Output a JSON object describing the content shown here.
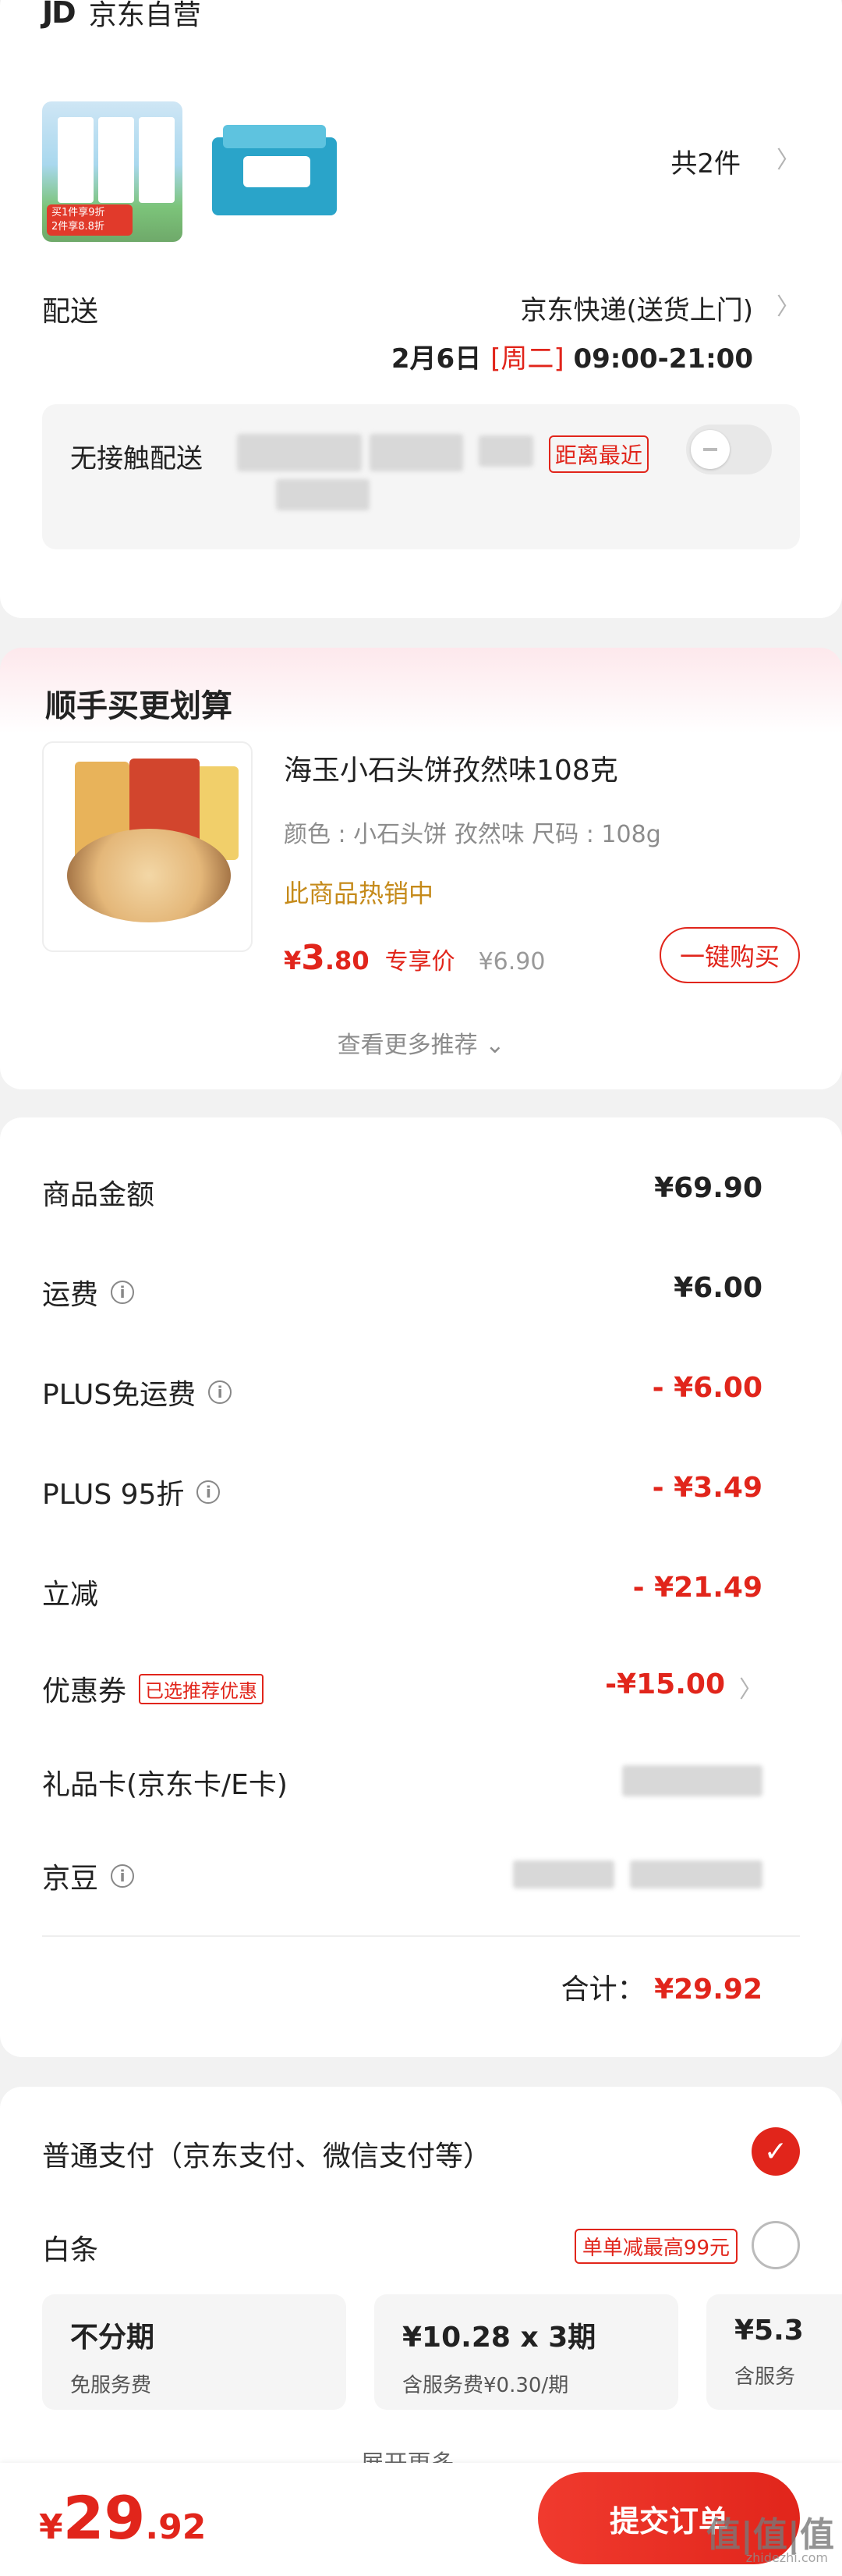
{
  "store": {
    "logo": "JD",
    "name": "京东自营"
  },
  "items": {
    "count_label": "共2件"
  },
  "thumb1": {
    "tag_line1": "买1件享9折",
    "tag_line2": "2件享8.8折"
  },
  "shipping": {
    "label": "配送",
    "type": "京东快递(送货上门)",
    "date": "2月6日",
    "weekday": "[周二]",
    "time": "09:00-21:00",
    "contactless_label": "无接触配送",
    "nearest_tag": "距离最近"
  },
  "addon": {
    "title": "顺手买更划算",
    "product_name": "海玉小石头饼孜然味108克",
    "spec": "颜色 : 小石头饼 孜然味   尺码 : 108g",
    "hot": "此商品热销中",
    "price_symbol": "¥",
    "price_int": "3",
    "price_dec": ".80",
    "exclusive": "专享价",
    "original_price": "¥6.90",
    "buy_label": "一键购买",
    "more_label": "查看更多推荐 ⌄"
  },
  "summary": {
    "goods_label": "商品金额",
    "goods_value": "¥69.90",
    "freight_label": "运费",
    "freight_value": "¥6.00",
    "plus_free_label": "PLUS免运费",
    "plus_free_value": "- ¥6.00",
    "plus95_label": "PLUS 95折",
    "plus95_value": "- ¥3.49",
    "instant_label": "立减",
    "instant_value": "- ¥21.49",
    "coupon_label": "优惠券",
    "coupon_tag": "已选推荐优惠",
    "coupon_value": "-¥15.00",
    "giftcard_label": "礼品卡(京东卡/E卡)",
    "jingdou_label": "京豆",
    "total_label": "合计：",
    "total_value": "¥29.92"
  },
  "payment": {
    "normal_label": "普通支付（京东支付、微信支付等）",
    "baitiao_label": "白条",
    "baitiao_tag": "单单减最高99元",
    "plans": [
      {
        "title": "不分期",
        "sub": "免服务费"
      },
      {
        "title": "¥10.28 x 3期",
        "sub": "含服务费¥0.30/期"
      },
      {
        "title": "¥5.3",
        "sub": "含服务"
      }
    ],
    "expand_label": "展开更多 ⌄"
  },
  "bottom": {
    "price_symbol": "¥",
    "price_int": "29",
    "price_dec": ".92",
    "submit_label": "提交订单",
    "watermark": "值|值|值",
    "watermark_sub": "zhidezhi.com"
  },
  "colors": {
    "accent": "#e1251b",
    "background": "#f2f2f2"
  }
}
